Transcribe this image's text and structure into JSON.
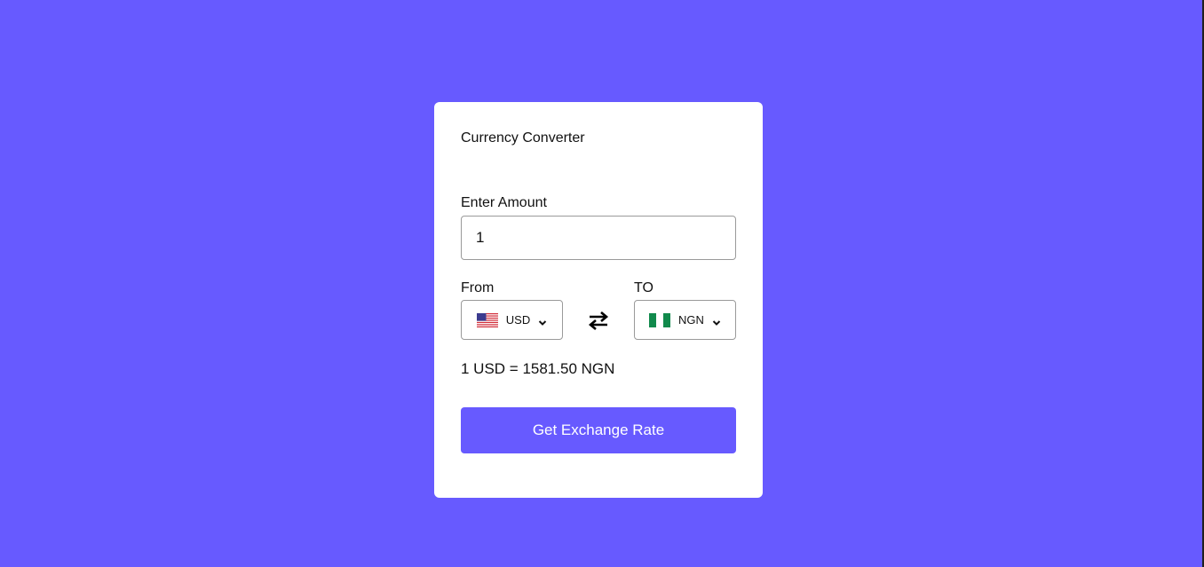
{
  "colors": {
    "background": "#675aff",
    "card": "#ffffff",
    "button": "#675aff",
    "button_text": "#ffffff"
  },
  "card": {
    "title": "Currency Converter",
    "amount": {
      "label": "Enter Amount",
      "value": "1"
    },
    "from": {
      "label": "From",
      "currency": "USD",
      "flag_icon": "us-flag-icon"
    },
    "to": {
      "label": "TO",
      "currency": "NGN",
      "flag_icon": "ng-flag-icon"
    },
    "swap_icon": "swap-arrows-icon",
    "result": "1 USD = 1581.50 NGN",
    "button_label": "Get Exchange Rate"
  }
}
